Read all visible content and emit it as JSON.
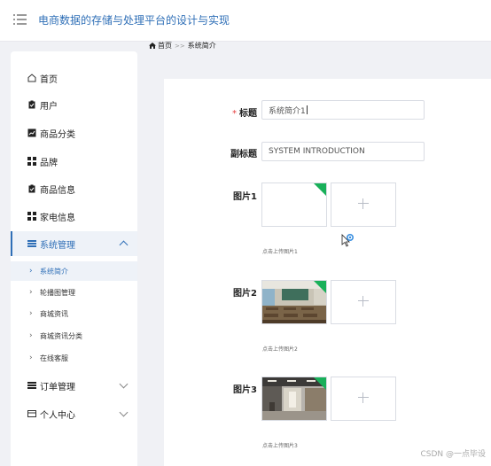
{
  "header": {
    "title": "电商数据的存储与处理平台的设计与实现"
  },
  "breadcrumb": {
    "home": "首页",
    "separator": ">>",
    "current": "系统简介"
  },
  "sidebar": {
    "items": [
      {
        "label": "首页",
        "icon": "home-icon"
      },
      {
        "label": "用户",
        "icon": "clipboard-icon"
      },
      {
        "label": "商品分类",
        "icon": "chart-icon"
      },
      {
        "label": "品牌",
        "icon": "grid-icon"
      },
      {
        "label": "商品信息",
        "icon": "clipboard-check-icon"
      },
      {
        "label": "家电信息",
        "icon": "grid-icon"
      },
      {
        "label": "系统管理",
        "icon": "list-icon",
        "expanded": true
      },
      {
        "label": "订单管理",
        "icon": "list-icon"
      },
      {
        "label": "个人中心",
        "icon": "card-icon"
      }
    ],
    "submenu": [
      "系统简介",
      "轮播图管理",
      "商城资讯",
      "商城资讯分类",
      "在线客服"
    ]
  },
  "form": {
    "title_label": "标题",
    "title_value": "系统简介1",
    "subtitle_label": "副标题",
    "subtitle_value": "SYSTEM INTRODUCTION",
    "image1_label": "图片1",
    "image1_hint": "点击上传图片1",
    "image2_label": "图片2",
    "image2_hint": "点击上传图片2",
    "image3_label": "图片3",
    "image3_hint": "点击上传图片3"
  },
  "watermark": "CSDN @一点毕设",
  "colors": {
    "accent": "#2f6fb7",
    "upload_badge": "#19b05a",
    "required": "#e53e3e"
  }
}
